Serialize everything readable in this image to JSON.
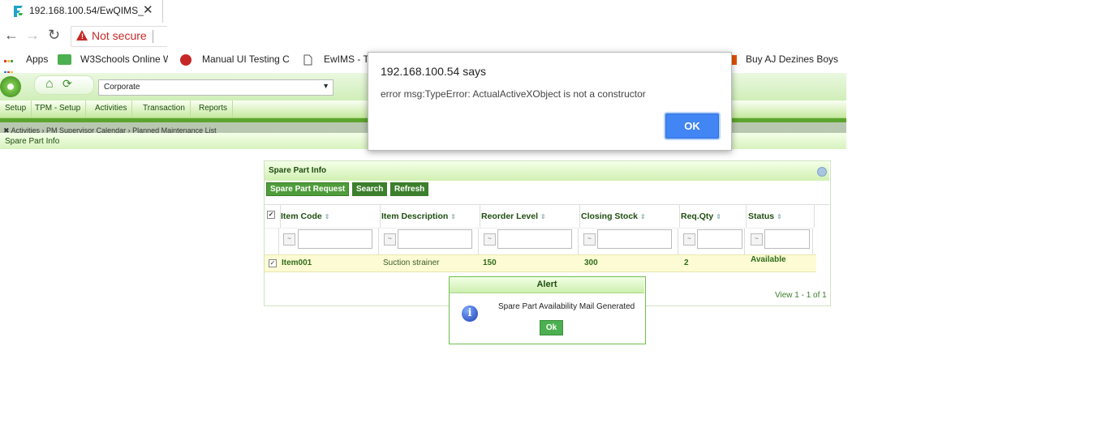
{
  "browser": {
    "tab_title": "192.168.100.54/EwQIMS_",
    "tab_close": "✕",
    "back": "←",
    "forward": "→",
    "reload": "↻",
    "security_label": "Not secure",
    "bookmarks": [
      {
        "label": "Apps"
      },
      {
        "label": "W3Schools Online W"
      },
      {
        "label": "Manual UI Testing C"
      },
      {
        "label": "EwIMS - T"
      },
      {
        "label": "Buy AJ Dezines Boys"
      }
    ]
  },
  "app": {
    "company_select": "Corporate",
    "menu": [
      "Setup",
      "TPM - Setup",
      "Activities",
      "Transaction",
      "Reports"
    ],
    "breadcrumb": "✖  Activities  ›  PM Supervisor Calendar  ›  Planned Maintenance List",
    "page_title": "Spare Part Info"
  },
  "panel": {
    "title": "Spare Part Info",
    "buttons": [
      "Spare Part Request",
      "Search",
      "Refresh"
    ],
    "columns": [
      "Item Code",
      "Item Description",
      "Reorder Level",
      "Closing Stock",
      "Req.Qty",
      "Status"
    ],
    "rows": [
      {
        "code": "Item001",
        "description": "Suction strainer",
        "reorder": "150",
        "closing": "300",
        "req_qty": "2",
        "status": "Available"
      }
    ],
    "pager": "View 1 - 1 of 1"
  },
  "alert": {
    "title": "Alert",
    "message": "Spare Part Availability Mail Generated",
    "ok": "Ok"
  },
  "dialog": {
    "title": "192.168.100.54 says",
    "message": "error msg:TypeError: ActualActiveXObject is not a constructor",
    "ok": "OK"
  },
  "colors": {
    "accent_green": "#5da42e",
    "dialog_button": "#4285f4",
    "warning": "#c62828"
  }
}
